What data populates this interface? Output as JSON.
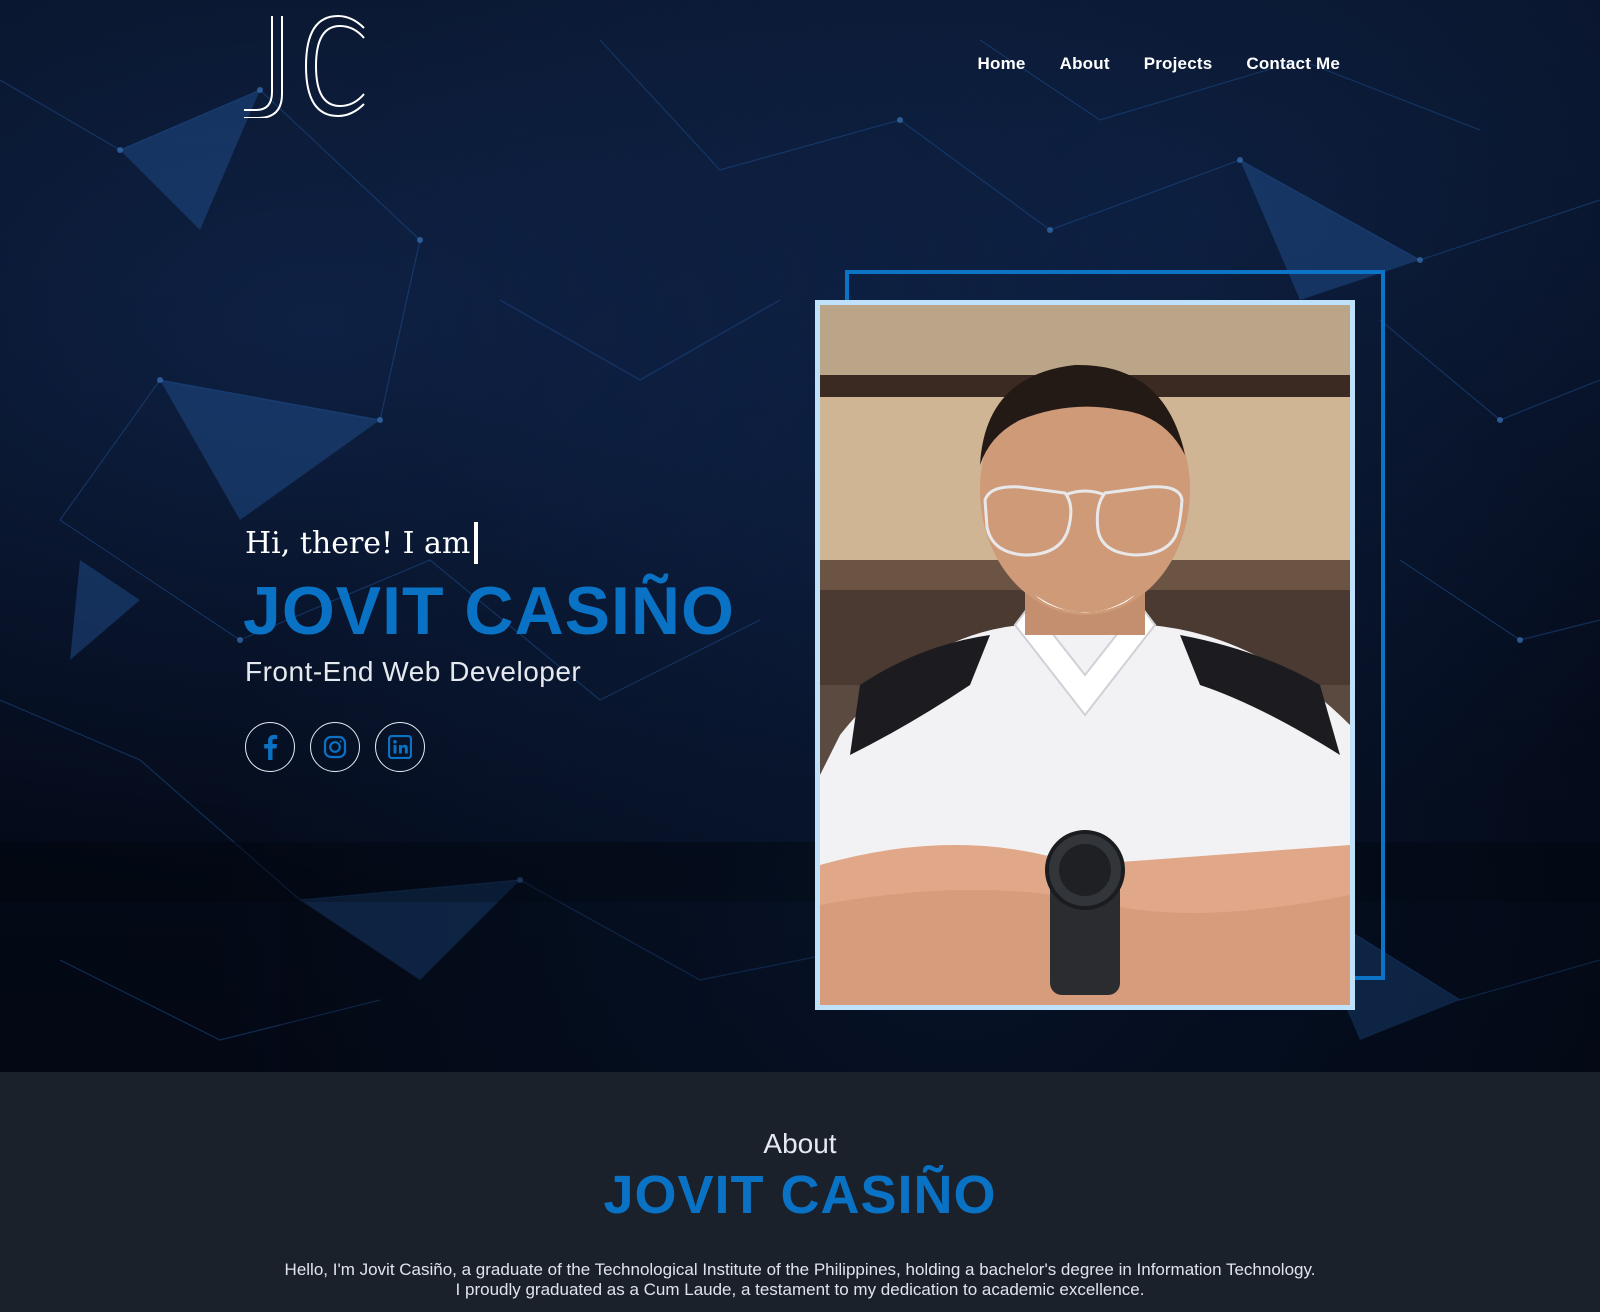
{
  "header": {
    "logo_text": "JC",
    "nav": [
      {
        "label": "Home"
      },
      {
        "label": "About"
      },
      {
        "label": "Projects"
      },
      {
        "label": "Contact Me"
      }
    ]
  },
  "hero": {
    "greeting": "Hi, there! I am",
    "name": "JOVIT CASIÑO",
    "role": "Front-End Web Developer",
    "socials": [
      {
        "icon": "facebook-icon"
      },
      {
        "icon": "instagram-icon"
      },
      {
        "icon": "linkedin-icon"
      }
    ]
  },
  "about": {
    "label": "About",
    "name": "JOVIT CASIÑO",
    "text": "Hello, I'm Jovit Casiño, a graduate of the Technological Institute of the Philippines, holding a bachelor's degree in Information Technology. I proudly graduated as a Cum Laude, a testament to my dedication to academic excellence."
  },
  "colors": {
    "accent": "#0a72c4",
    "frame_light": "#bfe2fa",
    "about_bg": "#1b212b"
  }
}
